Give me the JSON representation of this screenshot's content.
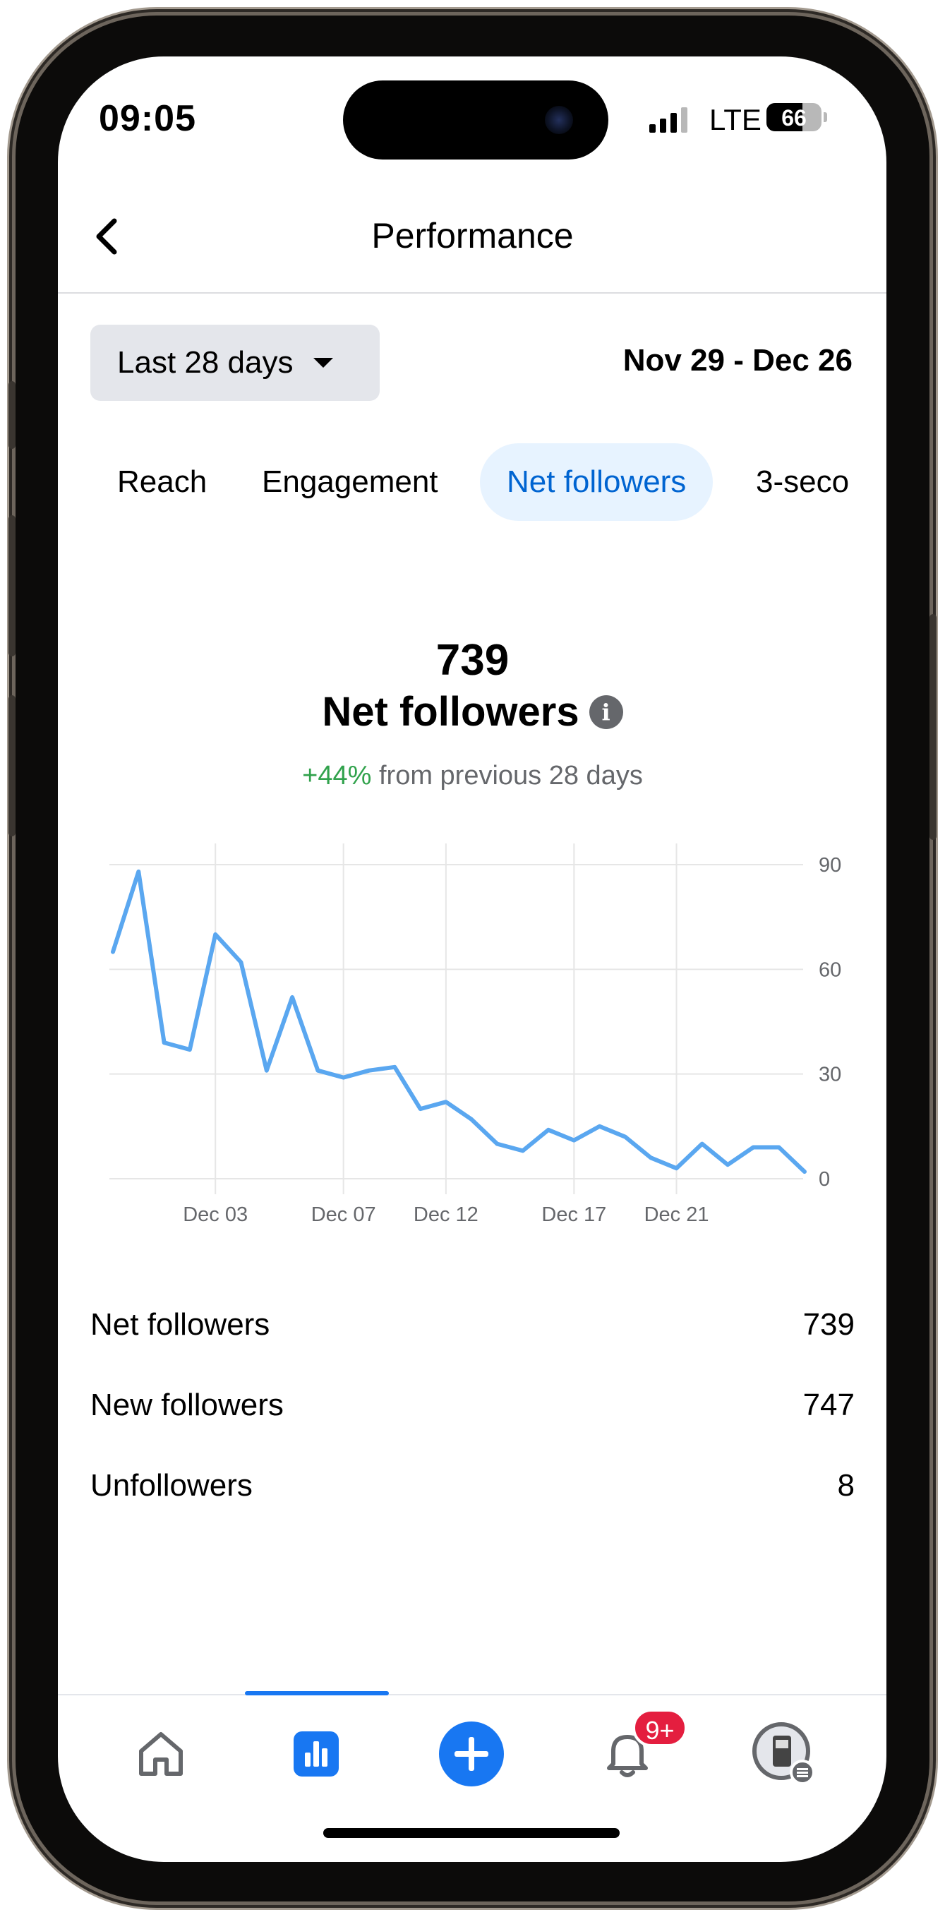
{
  "status_bar": {
    "time": "09:05",
    "network": "LTE",
    "battery": "66",
    "battery_level": 0.66
  },
  "header": {
    "title": "Performance"
  },
  "filters": {
    "range_label": "Last 28 days",
    "date_range": "Nov 29 - Dec 26"
  },
  "tabs": [
    {
      "label": "Reach",
      "active": false
    },
    {
      "label": "Engagement",
      "active": false
    },
    {
      "label": "Net followers",
      "active": true
    },
    {
      "label": "3-seco",
      "active": false
    }
  ],
  "headline": {
    "value": "739",
    "label": "Net followers",
    "info_icon": "i",
    "delta": "+44%",
    "delta_text": "from previous 28 days"
  },
  "chart_data": {
    "type": "line",
    "x": [
      "Nov 29",
      "Nov 30",
      "Dec 01",
      "Dec 02",
      "Dec 03",
      "Dec 04",
      "Dec 05",
      "Dec 06",
      "Dec 07",
      "Dec 08",
      "Dec 09",
      "Dec 10",
      "Dec 11",
      "Dec 12",
      "Dec 13",
      "Dec 14",
      "Dec 15",
      "Dec 16",
      "Dec 17",
      "Dec 18",
      "Dec 19",
      "Dec 20",
      "Dec 21",
      "Dec 22",
      "Dec 23",
      "Dec 24",
      "Dec 25",
      "Dec 26"
    ],
    "values": [
      65,
      88,
      39,
      37,
      70,
      62,
      31,
      52,
      31,
      29,
      31,
      32,
      20,
      22,
      17,
      10,
      8,
      14,
      11,
      15,
      12,
      6,
      3,
      10,
      4,
      9,
      9,
      2
    ],
    "x_tick_labels": [
      "Dec 03",
      "Dec 07",
      "Dec 12",
      "Dec 17",
      "Dec 21"
    ],
    "x_tick_index": [
      4,
      9,
      13,
      18,
      22
    ],
    "y_ticks": [
      0,
      30,
      60,
      90
    ],
    "ylim": [
      0,
      90
    ],
    "grid": true,
    "title": "",
    "xlabel": "",
    "ylabel": "",
    "line_color": "#5aa7f0"
  },
  "summary": [
    {
      "label": "Net followers",
      "value": "739"
    },
    {
      "label": "New followers",
      "value": "747"
    },
    {
      "label": "Unfollowers",
      "value": "8"
    }
  ],
  "nav": {
    "items": [
      "home-icon",
      "insights-icon",
      "create-icon",
      "notifications-icon",
      "profile-icon"
    ],
    "notification_badge": "9+",
    "active": "insights-icon"
  },
  "colors": {
    "accent": "#1877f2",
    "positive": "#31a24c",
    "badge": "#e41e3f"
  }
}
